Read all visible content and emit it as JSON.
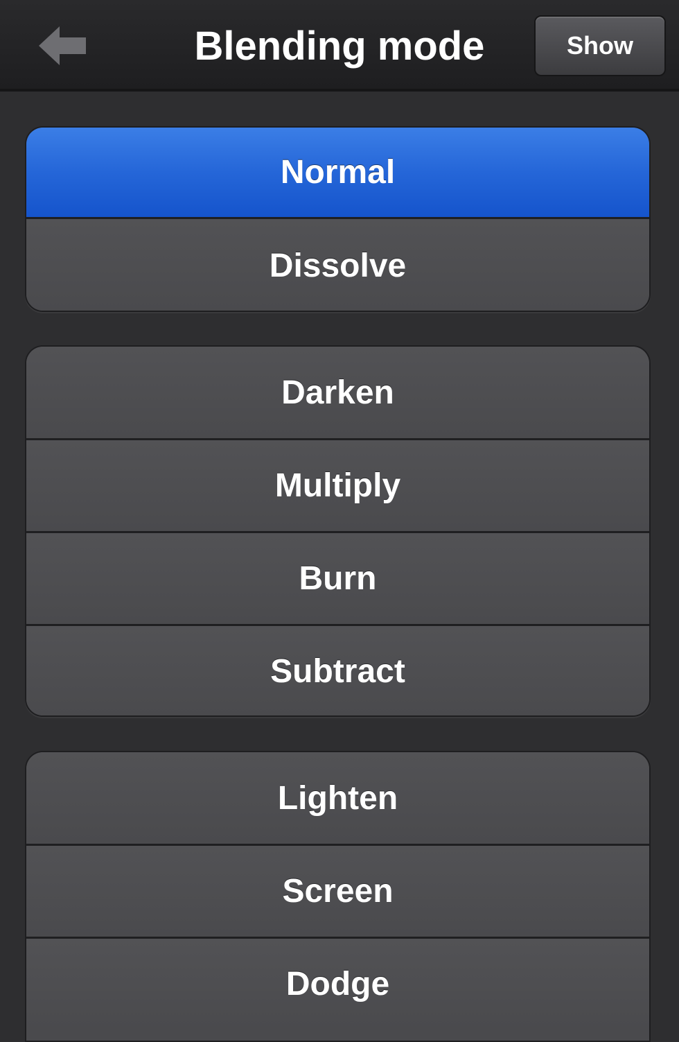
{
  "navbar": {
    "title": "Blending mode",
    "back_icon": "left-arrow-icon",
    "show_label": "Show"
  },
  "colors": {
    "background": "#2e2e30",
    "item_background": "#4a4a4d",
    "selected_accent": "#2566d8"
  },
  "groups": [
    {
      "items": [
        {
          "label": "Normal",
          "selected": true
        },
        {
          "label": "Dissolve",
          "selected": false
        }
      ]
    },
    {
      "items": [
        {
          "label": "Darken",
          "selected": false
        },
        {
          "label": "Multiply",
          "selected": false
        },
        {
          "label": "Burn",
          "selected": false
        },
        {
          "label": "Subtract",
          "selected": false
        }
      ]
    },
    {
      "items": [
        {
          "label": "Lighten",
          "selected": false
        },
        {
          "label": "Screen",
          "selected": false
        },
        {
          "label": "Dodge",
          "selected": false
        }
      ]
    }
  ]
}
